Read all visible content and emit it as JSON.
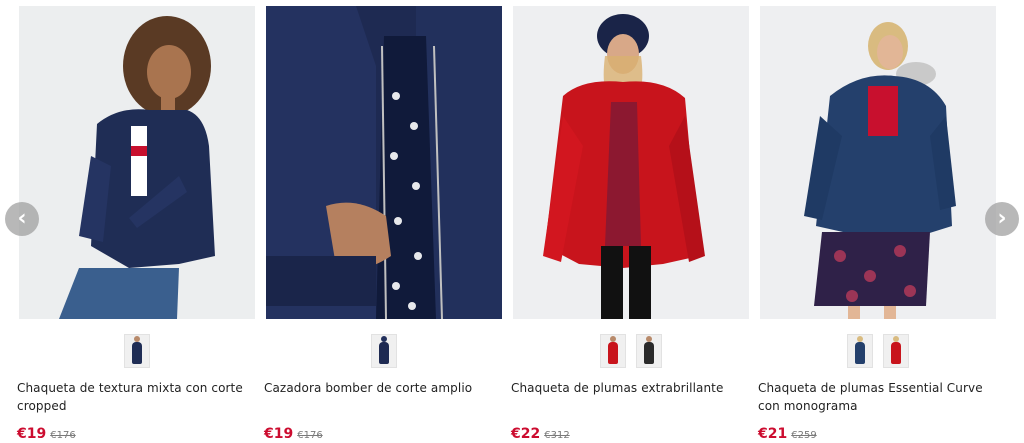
{
  "colors": {
    "sale_price": "#cc0c2f",
    "old_price": "#7a7a7a",
    "text": "#222222",
    "arrow_bg": "#a0a0a0"
  },
  "carousel": {
    "prev_icon": "chevron-left-icon",
    "next_icon": "chevron-right-icon",
    "prev_glyph": "‹",
    "next_glyph": "›",
    "products": [
      {
        "name": "Chaqueta de textura mixta con corte cropped",
        "price": "€19",
        "old_price": "€176",
        "swatches": [
          "navy"
        ]
      },
      {
        "name": "Cazadora bomber de corte amplio",
        "price": "€19",
        "old_price": "€176",
        "swatches": [
          "navy"
        ]
      },
      {
        "name": "Chaqueta de plumas extrabrillante",
        "price": "€22",
        "old_price": "€312",
        "swatches": [
          "red",
          "black"
        ]
      },
      {
        "name": "Chaqueta de plumas Essential Curve con monograma",
        "price": "€21",
        "old_price": "€259",
        "swatches": [
          "navy",
          "red"
        ]
      }
    ]
  }
}
